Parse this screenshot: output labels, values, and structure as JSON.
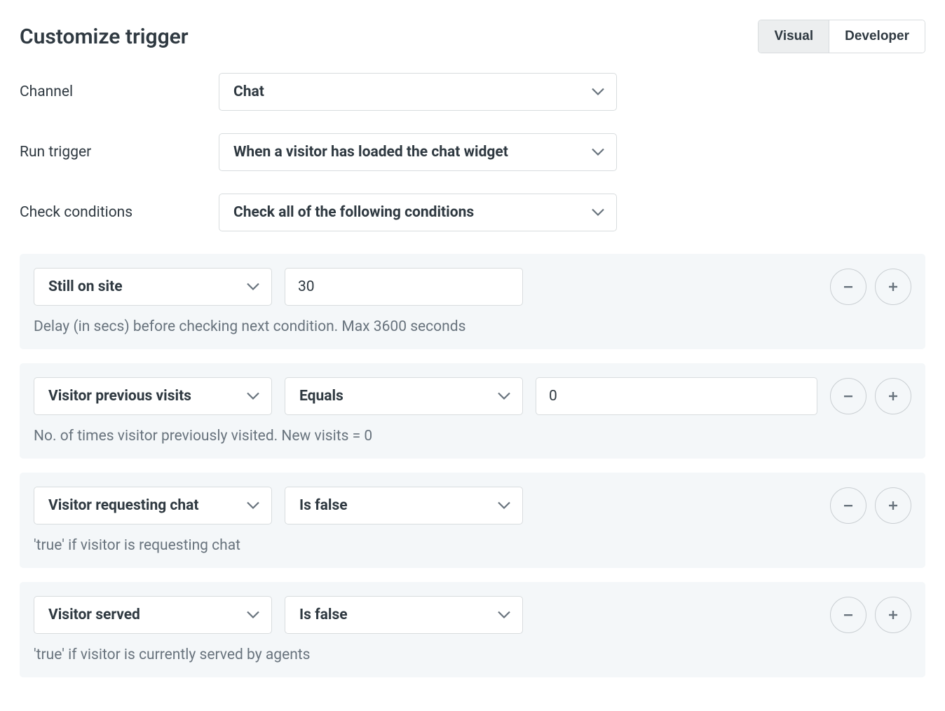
{
  "title": "Customize trigger",
  "tabs": {
    "visual": "Visual",
    "developer": "Developer"
  },
  "labels": {
    "channel": "Channel",
    "run_trigger": "Run trigger",
    "check_conditions": "Check conditions"
  },
  "values": {
    "channel": "Chat",
    "run_trigger": "When a visitor has loaded the chat widget",
    "check_conditions": "Check all of the following conditions"
  },
  "conditions": [
    {
      "field": "Still on site",
      "value": "30",
      "help": "Delay (in secs) before checking next condition. Max 3600 seconds"
    },
    {
      "field": "Visitor previous visits",
      "operator": "Equals",
      "value": "0",
      "help": "No. of times visitor previously visited. New visits = 0"
    },
    {
      "field": "Visitor requesting chat",
      "operator": "Is false",
      "help": "'true' if visitor is requesting chat"
    },
    {
      "field": "Visitor served",
      "operator": "Is false",
      "help": "'true' if visitor is currently served by agents"
    }
  ]
}
